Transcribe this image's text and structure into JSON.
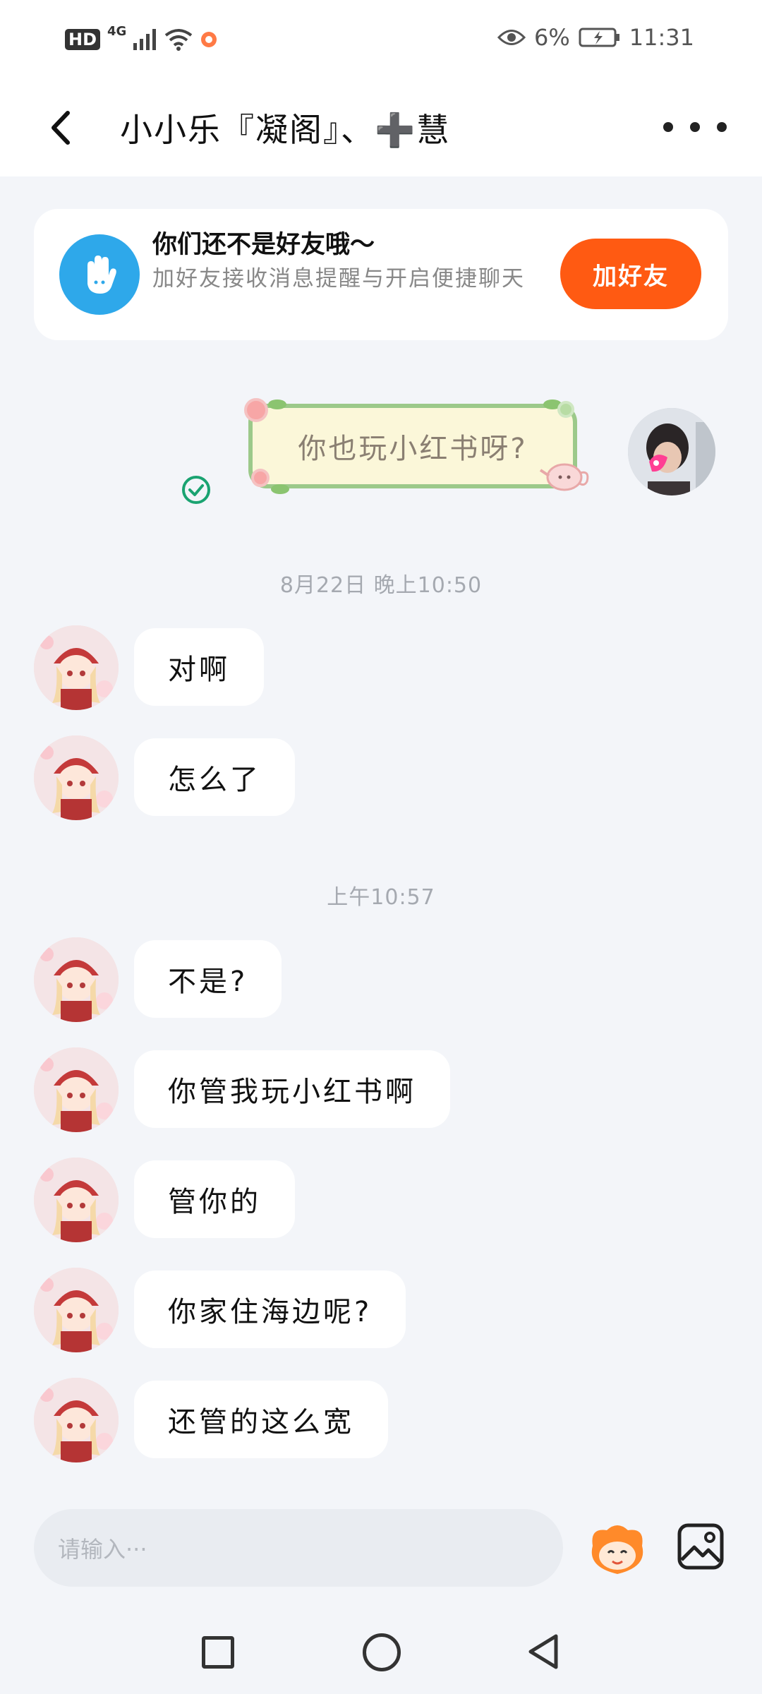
{
  "status_bar": {
    "hd": "HD",
    "network": "4G",
    "battery_pct": "6%",
    "time": "11:31"
  },
  "header": {
    "title": "小小乐『凝阁』、➕慧"
  },
  "friend_prompt": {
    "title": "你们还不是好友哦～",
    "description": "加好友接收消息提醒与开启便捷聊天",
    "button_label": "加好友"
  },
  "sent_message": {
    "text": "你也玩小红书呀?",
    "read": true
  },
  "timestamps": [
    "8月22日 晚上10:50",
    "上午10:57"
  ],
  "messages_group_1": [
    {
      "text": "对啊"
    },
    {
      "text": "怎么了"
    }
  ],
  "messages_group_2": [
    {
      "text": "不是?"
    },
    {
      "text": "你管我玩小红书啊"
    },
    {
      "text": "管你的"
    },
    {
      "text": "你家住海边呢?"
    },
    {
      "text": "还管的这么宽"
    }
  ],
  "input": {
    "placeholder": "请输入···"
  },
  "colors": {
    "accent": "#ff5a12",
    "friend_icon": "#2ea8ea",
    "sticker_border": "#9cc98a",
    "check": "#1aa371"
  }
}
